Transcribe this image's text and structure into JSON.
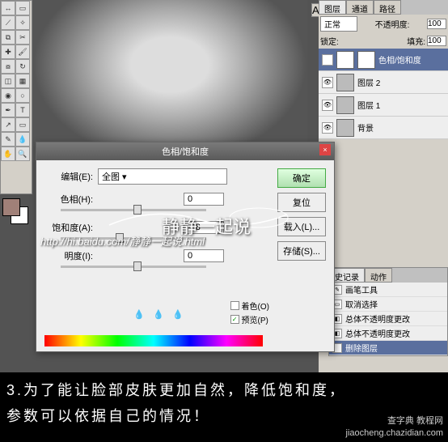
{
  "workspace": {
    "text_tool_label": "A|"
  },
  "layers_panel": {
    "tabs": {
      "layers": "图层",
      "channels": "通道",
      "paths": "路径"
    },
    "blend_mode": "正常",
    "opacity_label": "不透明度:",
    "opacity_value": "100",
    "lock_label": "锁定:",
    "fill_label": "填充:",
    "fill_value": "100",
    "layers": [
      {
        "name": "色相/饱和度"
      },
      {
        "name": "图层 2"
      },
      {
        "name": "图层 1"
      },
      {
        "name": "背景"
      }
    ]
  },
  "history_panel": {
    "tabs": {
      "history": "史记录",
      "actions": "动作"
    },
    "items": [
      "画笔工具",
      "取消选择",
      "总体不透明度更改",
      "总体不透明度更改",
      "删除图层"
    ]
  },
  "dialog": {
    "title": "色相/饱和度",
    "edit_label": "编辑(E):",
    "edit_value": "全图",
    "hue_label": "色相(H):",
    "hue_value": "0",
    "sat_label": "饱和度(A):",
    "sat_value": "-38",
    "light_label": "明度(I):",
    "light_value": "0",
    "ok": "确定",
    "cancel": "复位",
    "load": "载入(L)...",
    "save": "存储(S)...",
    "colorize_label": "着色(O)",
    "preview_label": "预览(P)",
    "preview_checked": "✓"
  },
  "watermark": {
    "url": "http://hi.baidu.com/",
    "brand": "静静一起说",
    "suffix": ".html"
  },
  "caption": {
    "line1": "3.为了能让脸部皮肤更加自然，降低饱和度，",
    "line2": "参数可以依据自己的情况！",
    "credit1": "查字典 教程网",
    "credit2": "jiaocheng.chazidian.com"
  }
}
